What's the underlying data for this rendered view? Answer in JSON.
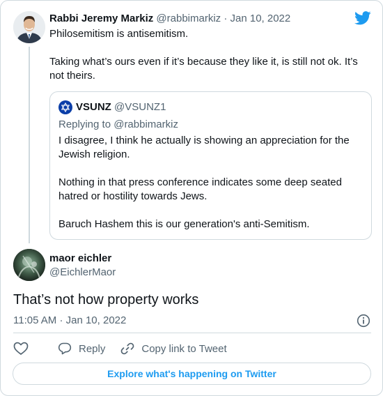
{
  "colors": {
    "accent": "#1d9bf0",
    "muted": "#536471",
    "text": "#0f1419",
    "border": "#cfd9de"
  },
  "parent_tweet": {
    "name": "Rabbi Jeremy Markiz",
    "handle": "@rabbimarkiz",
    "separator": "·",
    "date": "Jan 10, 2022",
    "text": [
      "Philosemitism is antisemitism.",
      "Taking what’s ours even if it’s because they like it, is still not ok. It’s not theirs."
    ]
  },
  "quoted_tweet": {
    "name": "VSUNZ",
    "handle": "@VSUNZ1",
    "replying_to": "Replying to @rabbimarkiz",
    "text": [
      "I disagree, I think he actually is showing an appreciation for the Jewish religion.",
      "Nothing in that press conference indicates some deep seated hatred or hostility towards Jews.",
      "Baruch Hashem this is our generation's anti-Semitism."
    ]
  },
  "main_tweet": {
    "name": "maor eichler",
    "handle": "@EichlerMaor",
    "text": "That’s not how property works",
    "time": "11:05 AM",
    "separator": "·",
    "date": "Jan 10, 2022"
  },
  "actions": {
    "like_icon": "heart-icon",
    "reply_label": "Reply",
    "copy_label": "Copy link to Tweet"
  },
  "explore_label": "Explore what's happening on Twitter"
}
